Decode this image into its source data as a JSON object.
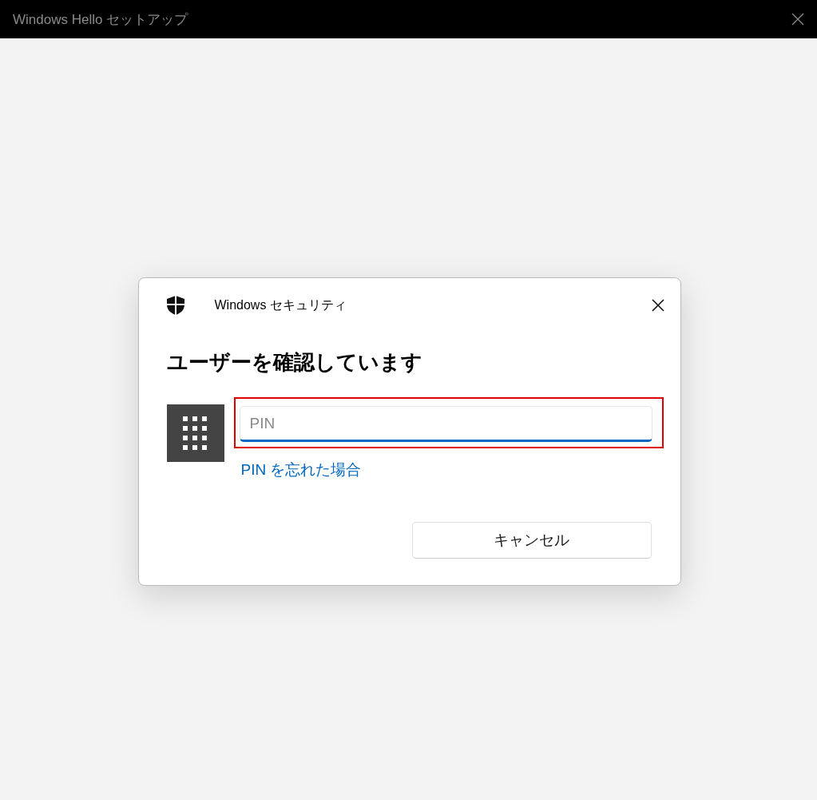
{
  "window": {
    "title": "Windows Hello セットアップ"
  },
  "dialog": {
    "app_title": "Windows セキュリティ",
    "heading": "ユーザーを確認しています",
    "pin_field": {
      "placeholder": "PIN",
      "focused": true,
      "highlighted": true
    },
    "forgot_link": "PIN を忘れた場合",
    "buttons": [
      "キャンセル"
    ]
  }
}
